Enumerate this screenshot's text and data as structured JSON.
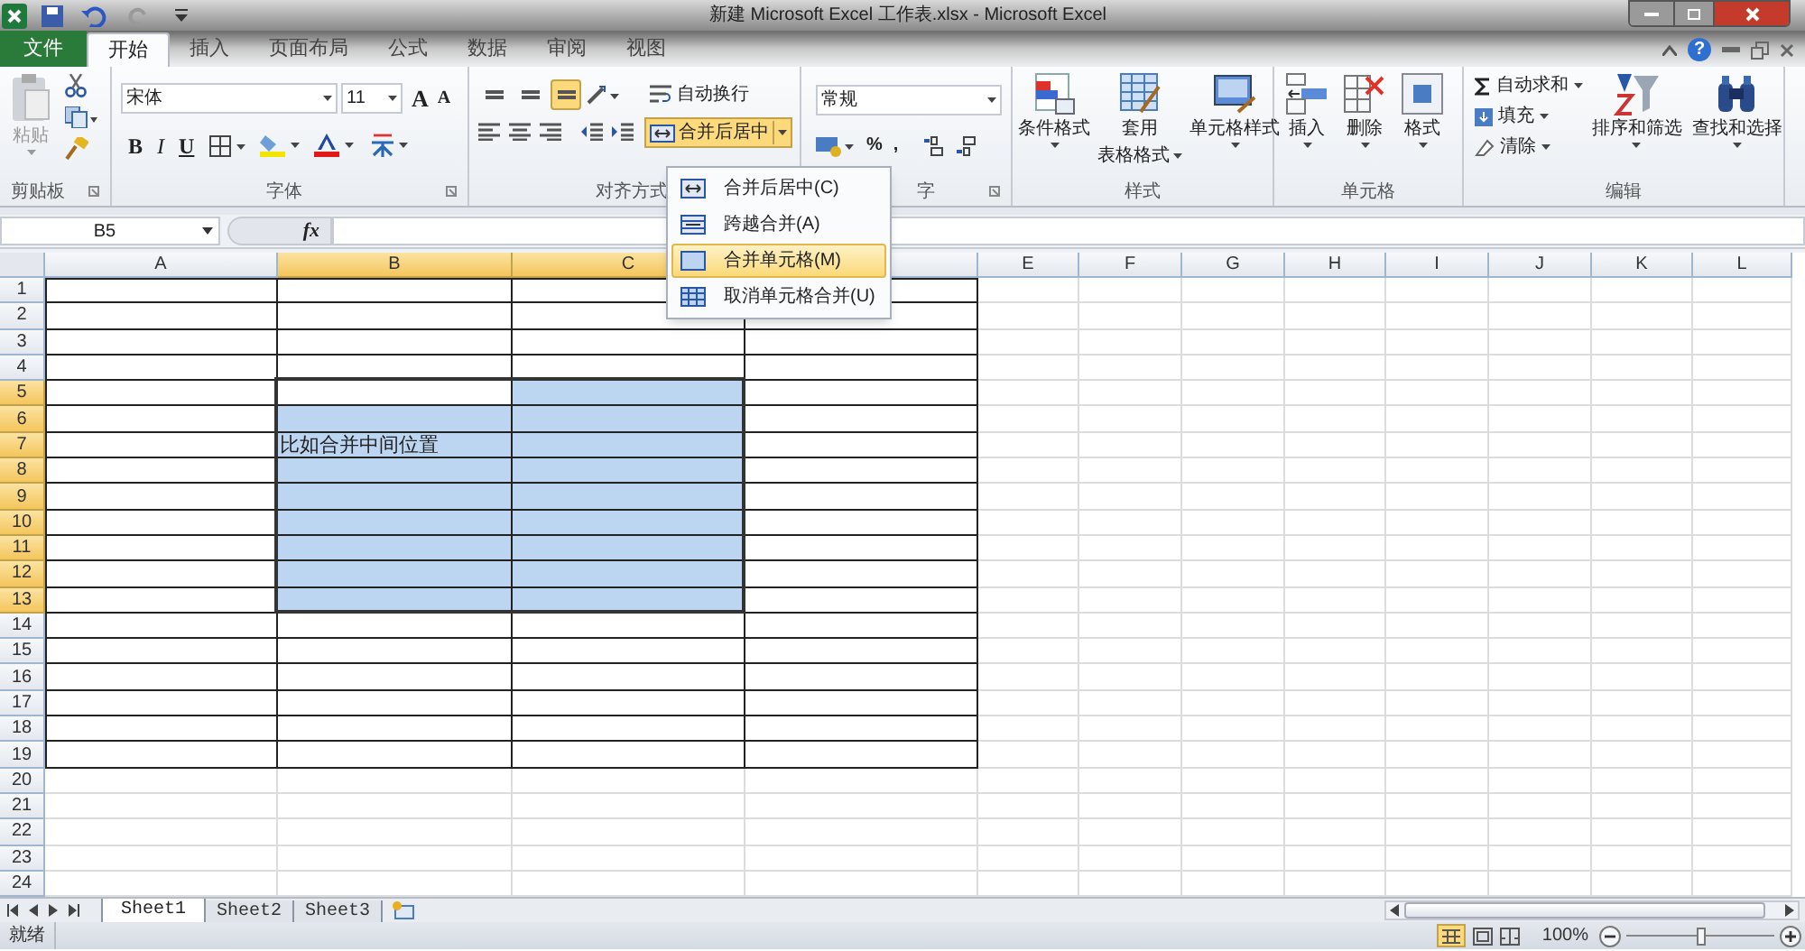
{
  "title_bar": {
    "title": "新建 Microsoft Excel 工作表.xlsx - Microsoft Excel"
  },
  "ribbon_tabs": [
    {
      "label": "文件",
      "kind": "file",
      "selected": false
    },
    {
      "label": "开始",
      "kind": "tab",
      "selected": true
    },
    {
      "label": "插入",
      "kind": "tab",
      "selected": false
    },
    {
      "label": "页面布局",
      "kind": "tab",
      "selected": false
    },
    {
      "label": "公式",
      "kind": "tab",
      "selected": false
    },
    {
      "label": "数据",
      "kind": "tab",
      "selected": false
    },
    {
      "label": "审阅",
      "kind": "tab",
      "selected": false
    },
    {
      "label": "视图",
      "kind": "tab",
      "selected": false
    }
  ],
  "help": "?",
  "ribbon": {
    "clipboard": {
      "label": "剪贴板",
      "paste": "粘贴"
    },
    "font": {
      "label": "字体",
      "font_name": "宋体",
      "font_size": "11",
      "grow": "A",
      "shrink": "A",
      "bold": "B",
      "italic": "I",
      "underline": "U"
    },
    "alignment": {
      "label": "对齐方式",
      "vertical_align": [
        {
          "selected": false
        },
        {
          "selected": false
        },
        {
          "selected": true
        }
      ],
      "wrap_text": "自动换行",
      "merge_center": {
        "label": "合并后居中",
        "selected": true
      }
    },
    "number": {
      "label": "字",
      "format": "常规",
      "percent": "%",
      "comma": ","
    },
    "styles": {
      "label": "样式",
      "conditional": "条件格式",
      "table_line1": "套用",
      "table_line2": "表格格式",
      "cell_styles": "单元格样式"
    },
    "cells": {
      "label": "单元格",
      "insert": "插入",
      "delete": "删除",
      "format": "格式"
    },
    "editing": {
      "label": "编辑",
      "autosum": "自动求和",
      "fill": "填充",
      "clear": "清除",
      "sort": "排序和筛选",
      "find": "查找和选择"
    }
  },
  "merge_menu": [
    {
      "label": "合并后居中(C)",
      "selected": false
    },
    {
      "label": "跨越合并(A)",
      "selected": false
    },
    {
      "label": "合并单元格(M)",
      "selected": true
    },
    {
      "label": "取消单元格合并(U)",
      "selected": false
    }
  ],
  "formula_bar": {
    "name_box": "B5",
    "function_label": "fx"
  },
  "columns": [
    {
      "label": "A",
      "selected": false,
      "bordered": true
    },
    {
      "label": "B",
      "selected": true,
      "bordered": true
    },
    {
      "label": "C",
      "selected": true,
      "bordered": true
    },
    {
      "selected": false,
      "bordered": true
    },
    {
      "label": "E",
      "selected": false,
      "bordered": false
    },
    {
      "label": "F",
      "selected": false,
      "bordered": false
    },
    {
      "label": "G",
      "selected": false,
      "bordered": false
    },
    {
      "label": "H",
      "selected": false,
      "bordered": false
    },
    {
      "label": "I",
      "selected": false,
      "bordered": false
    },
    {
      "label": "J",
      "selected": false,
      "bordered": false
    },
    {
      "label": "K",
      "selected": false,
      "bordered": false
    },
    {
      "label": "L",
      "selected": false,
      "bordered": false
    }
  ],
  "rows": [
    {
      "label": "1",
      "selected": false,
      "bordered": true
    },
    {
      "label": "2",
      "selected": false,
      "bordered": true
    },
    {
      "label": "3",
      "selected": false,
      "bordered": true
    },
    {
      "label": "4",
      "selected": false,
      "bordered": true
    },
    {
      "label": "5",
      "selected": true,
      "bordered": true
    },
    {
      "label": "6",
      "selected": true,
      "bordered": true
    },
    {
      "label": "7",
      "selected": true,
      "bordered": true,
      "cell_text": "比如合并中间位置"
    },
    {
      "label": "8",
      "selected": true,
      "bordered": true
    },
    {
      "label": "9",
      "selected": true,
      "bordered": true
    },
    {
      "label": "10",
      "selected": true,
      "bordered": true
    },
    {
      "label": "11",
      "selected": true,
      "bordered": true
    },
    {
      "label": "12",
      "selected": true,
      "bordered": true
    },
    {
      "label": "13",
      "selected": true,
      "bordered": true
    },
    {
      "label": "14",
      "selected": false,
      "bordered": true
    },
    {
      "label": "15",
      "selected": false,
      "bordered": true
    },
    {
      "label": "16",
      "selected": false,
      "bordered": true
    },
    {
      "label": "17",
      "selected": false,
      "bordered": true
    },
    {
      "label": "18",
      "selected": false,
      "bordered": true
    },
    {
      "label": "19",
      "selected": false,
      "bordered": true
    },
    {
      "label": "20",
      "selected": false,
      "bordered": false
    },
    {
      "label": "21",
      "selected": false,
      "bordered": false
    },
    {
      "label": "22",
      "selected": false,
      "bordered": false
    },
    {
      "label": "23",
      "selected": false,
      "bordered": false
    },
    {
      "label": "24",
      "selected": false,
      "bordered": false
    }
  ],
  "sheet_tabs": [
    {
      "label": "Sheet1",
      "selected": true
    },
    {
      "label": "Sheet2",
      "selected": false
    },
    {
      "label": "Sheet3",
      "selected": false
    }
  ],
  "status_bar": {
    "status": "就绪",
    "zoom": "100%",
    "zoom_slider": {
      "level": 0.5
    }
  }
}
